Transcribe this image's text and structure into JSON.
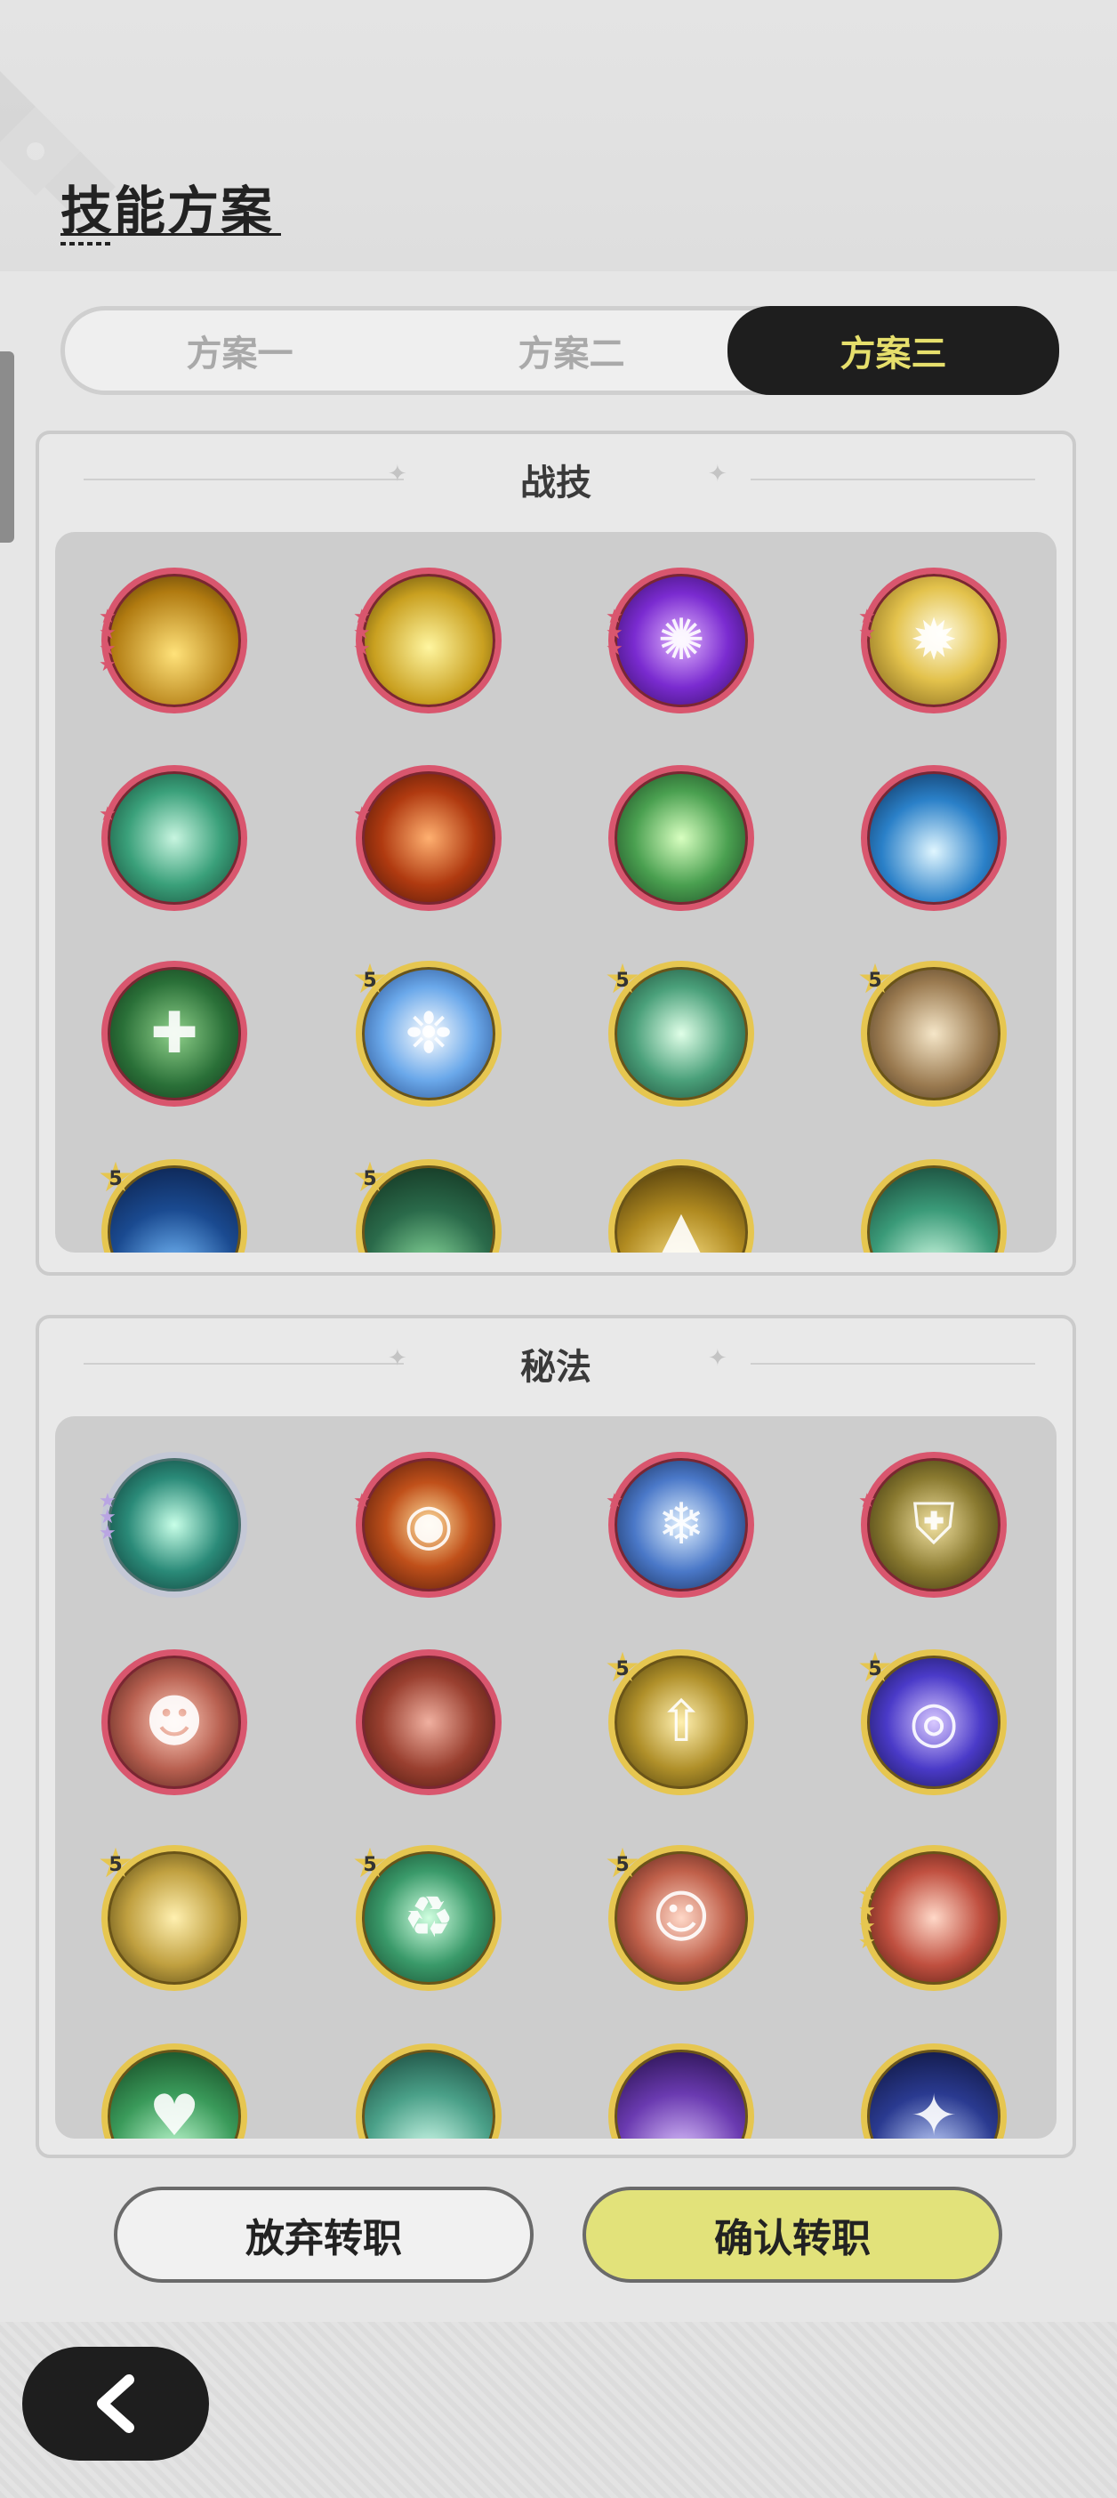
{
  "page": {
    "title": "技能方案"
  },
  "tabs": [
    {
      "label": "方案一",
      "active": false
    },
    {
      "label": "方案二",
      "active": false
    },
    {
      "label": "方案三",
      "active": true
    }
  ],
  "combat_skills": {
    "title": "战技",
    "icons": [
      {
        "name": "golden-spike-burst-icon",
        "frame": "red",
        "stars": "4-red"
      },
      {
        "name": "lightning-orb-icon",
        "frame": "red",
        "stars": "3-red"
      },
      {
        "name": "purple-storm-icon",
        "frame": "red",
        "stars": "3-red"
      },
      {
        "name": "radiant-sun-icon",
        "frame": "red",
        "stars": "2-red"
      },
      {
        "name": "green-whirlwind-icon",
        "frame": "red",
        "stars": "1-red"
      },
      {
        "name": "magma-crack-icon",
        "frame": "red",
        "stars": "1-red"
      },
      {
        "name": "green-flame-icon",
        "frame": "red",
        "stars": ""
      },
      {
        "name": "blue-wave-icon",
        "frame": "red",
        "stars": ""
      },
      {
        "name": "healing-cross-icon",
        "frame": "red",
        "stars": ""
      },
      {
        "name": "ice-shards-icon",
        "frame": "gold",
        "badge": "5"
      },
      {
        "name": "wind-sphere-icon",
        "frame": "gold",
        "badge": "5"
      },
      {
        "name": "paper-talisman-icon",
        "frame": "gold",
        "badge": "5"
      },
      {
        "name": "blue-tide-icon",
        "frame": "gold",
        "badge": "5"
      },
      {
        "name": "thorn-vine-icon",
        "frame": "gold",
        "badge": "5"
      },
      {
        "name": "golden-spike-icon",
        "frame": "gold",
        "stars": "gold"
      },
      {
        "name": "wind-slash-icon",
        "frame": "gold",
        "stars": "gold"
      }
    ]
  },
  "secret_arts": {
    "title": "秘法",
    "icons": [
      {
        "name": "crystal-leaf-icon",
        "frame": "silver",
        "stars": "3-lav"
      },
      {
        "name": "fire-orb-icon",
        "frame": "red",
        "stars": "1-red"
      },
      {
        "name": "ice-crystal-icon",
        "frame": "red",
        "stars": "1-red"
      },
      {
        "name": "shield-icon",
        "frame": "red",
        "stars": "1-red"
      },
      {
        "name": "heal-figure-icon",
        "frame": "red",
        "stars": ""
      },
      {
        "name": "demon-face-icon",
        "frame": "red",
        "stars": ""
      },
      {
        "name": "arrow-up-icon",
        "frame": "gold",
        "badge": "5"
      },
      {
        "name": "clock-vortex-icon",
        "frame": "gold",
        "badge": "5"
      },
      {
        "name": "golden-wing-icon",
        "frame": "gold",
        "badge": "5"
      },
      {
        "name": "recycle-leaf-icon",
        "frame": "gold",
        "badge": "5"
      },
      {
        "name": "meditating-figure-icon",
        "frame": "gold",
        "badge": "5"
      },
      {
        "name": "flame-fist-icon",
        "frame": "gold",
        "stars": "4-gold"
      },
      {
        "name": "green-heart-icon",
        "frame": "gold",
        "stars": "gold"
      },
      {
        "name": "swirl-orb-icon",
        "frame": "gold",
        "stars": "gold"
      },
      {
        "name": "purple-vortex-icon",
        "frame": "gold",
        "stars": "gold"
      },
      {
        "name": "starry-night-icon",
        "frame": "gold",
        "stars": "gold"
      }
    ]
  },
  "buttons": {
    "abandon": "放弃转职",
    "confirm": "确认转职"
  },
  "colors": {
    "accent_gold": "#e6df6c",
    "frame_red": "#d9566e",
    "frame_gold": "#e6c650",
    "dark": "#1e1e1e"
  }
}
